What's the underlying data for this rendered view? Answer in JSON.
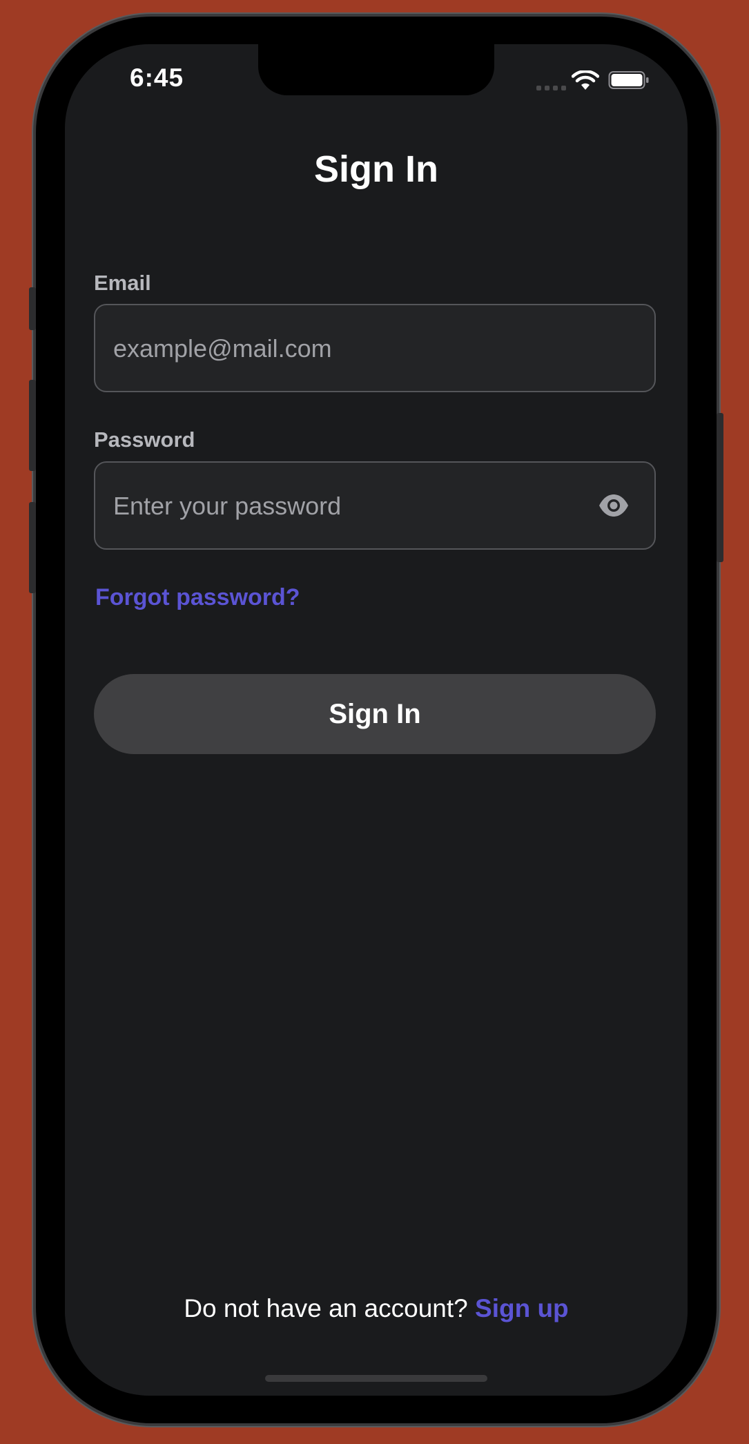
{
  "status_bar": {
    "time": "6:45"
  },
  "header": {
    "title": "Sign In"
  },
  "form": {
    "email": {
      "label": "Email",
      "value": "",
      "placeholder": "example@mail.com"
    },
    "password": {
      "label": "Password",
      "value": "",
      "placeholder": "Enter your password"
    },
    "forgot_password_label": "Forgot password?",
    "submit_label": "Sign In"
  },
  "footer": {
    "prompt": "Do not have an account?",
    "signup_label": "Sign up"
  },
  "colors": {
    "background": "#1a1b1d",
    "accent": "#5b54d4",
    "button": "#404042",
    "frame_backdrop": "#9f3b24"
  },
  "icons": {
    "wifi": "wifi-icon",
    "battery": "battery-icon",
    "password_toggle": "eye-icon"
  }
}
